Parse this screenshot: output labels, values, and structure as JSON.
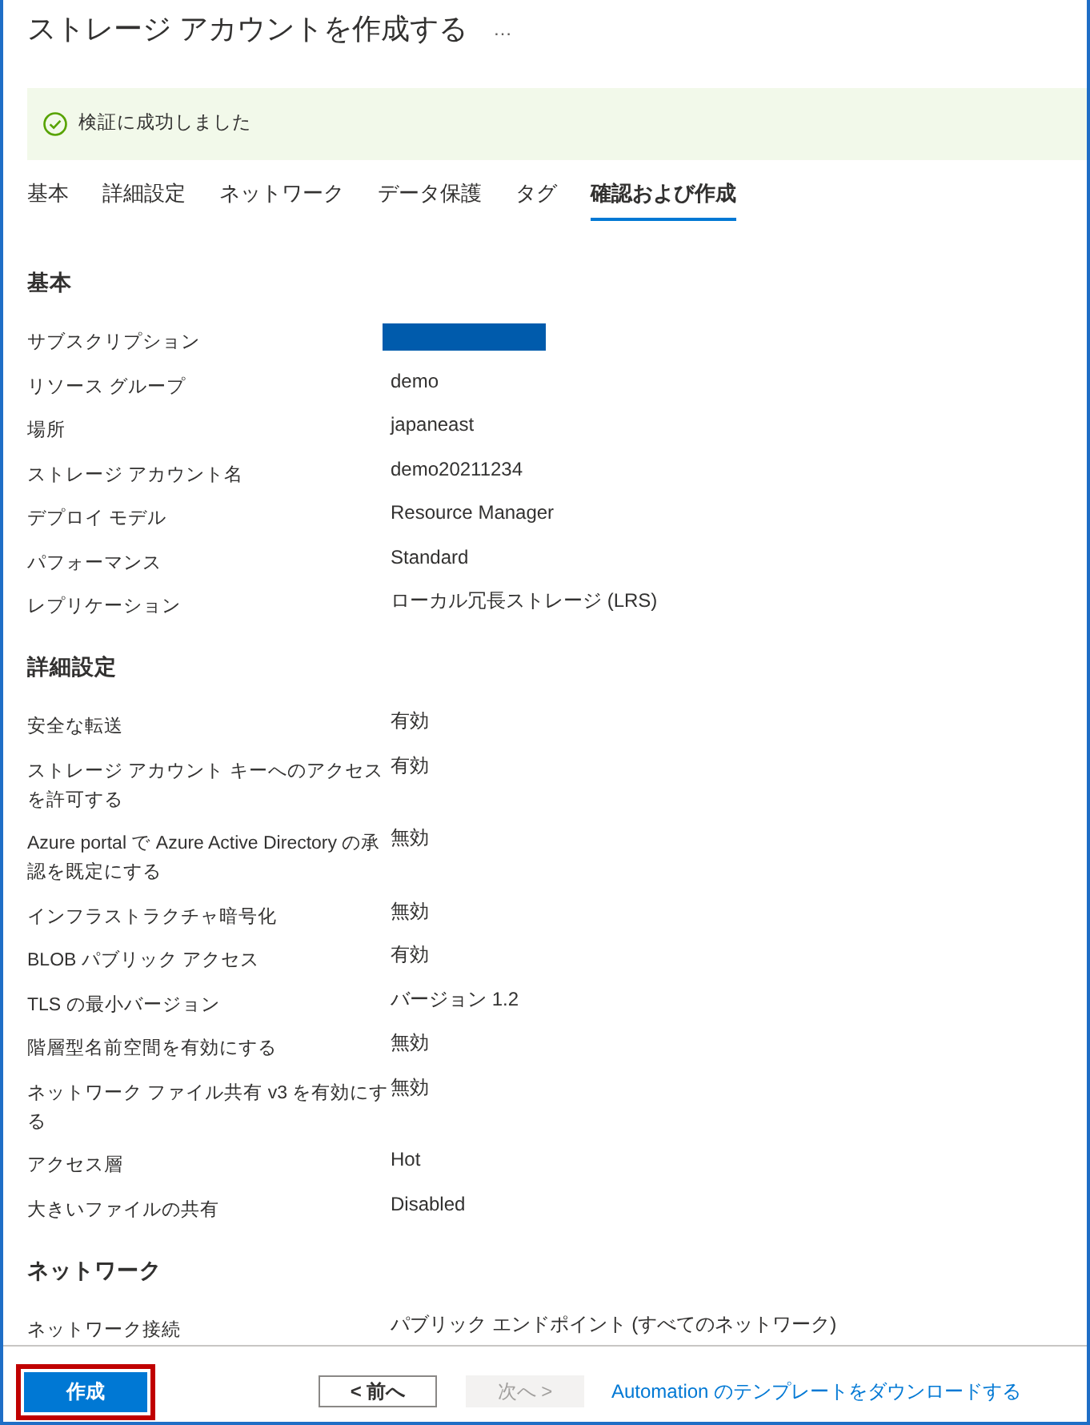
{
  "window": {
    "title": "ストレージ アカウントを作成する",
    "more_label": "…"
  },
  "banner": {
    "kind": "success",
    "message": "検証に成功しました"
  },
  "tabs": [
    {
      "label": "基本",
      "selected": false
    },
    {
      "label": "詳細設定",
      "selected": false
    },
    {
      "label": "ネットワーク",
      "selected": false
    },
    {
      "label": "データ保護",
      "selected": false
    },
    {
      "label": "タグ",
      "selected": false
    },
    {
      "label": "確認および作成",
      "selected": true
    }
  ],
  "sections": [
    {
      "title": "基本",
      "rows": [
        {
          "kind": "redacted",
          "label": "サブスクリプション"
        },
        {
          "kind": "text",
          "label": "リソース グループ",
          "value": "demo"
        },
        {
          "kind": "text",
          "label": "場所",
          "value": "japaneast"
        },
        {
          "kind": "text",
          "label": "ストレージ アカウント名",
          "value": "demo20211234"
        },
        {
          "kind": "text",
          "label": "デプロイ モデル",
          "value": "Resource Manager"
        },
        {
          "kind": "text",
          "label": "パフォーマンス",
          "value": "Standard"
        },
        {
          "kind": "text",
          "label": "レプリケーション",
          "value": "ローカル冗長ストレージ (LRS)"
        }
      ]
    },
    {
      "title": "詳細設定",
      "rows": [
        {
          "kind": "text",
          "label": "安全な転送",
          "value": "有効"
        },
        {
          "kind": "text",
          "label": "ストレージ アカウント キーへのアクセスを許可する",
          "value": "有効"
        },
        {
          "kind": "text",
          "label": "Azure portal で Azure Active Directory の承認を既定にする",
          "value": "無効"
        },
        {
          "kind": "text",
          "label": "インフラストラクチャ暗号化",
          "value": "無効"
        },
        {
          "kind": "text",
          "label": "BLOB パブリック アクセス",
          "value": "有効"
        },
        {
          "kind": "text",
          "label": "TLS の最小バージョン",
          "value": "バージョン 1.2"
        },
        {
          "kind": "text",
          "label": "階層型名前空間を有効にする",
          "value": "無効"
        },
        {
          "kind": "text",
          "label": "ネットワーク ファイル共有 v3 を有効にする",
          "value": "無効"
        },
        {
          "kind": "text",
          "label": "アクセス層",
          "value": "Hot"
        },
        {
          "kind": "text",
          "label": "大きいファイルの共有",
          "value": "Disabled"
        }
      ]
    },
    {
      "title": "ネットワーク",
      "rows": [
        {
          "kind": "text",
          "label": "ネットワーク接続",
          "value": "パブリック エンドポイント (すべてのネットワーク)"
        }
      ]
    }
  ],
  "footer": {
    "buttons": [
      {
        "label": "作成",
        "kind": "primary",
        "highlighted": true,
        "disabled": false
      },
      {
        "label": "< 前へ",
        "kind": "secondary",
        "highlighted": false,
        "disabled": false
      },
      {
        "label": "次へ >",
        "kind": "secondary",
        "highlighted": false,
        "disabled": true
      }
    ],
    "link": "Automation のテンプレートをダウンロードする"
  }
}
